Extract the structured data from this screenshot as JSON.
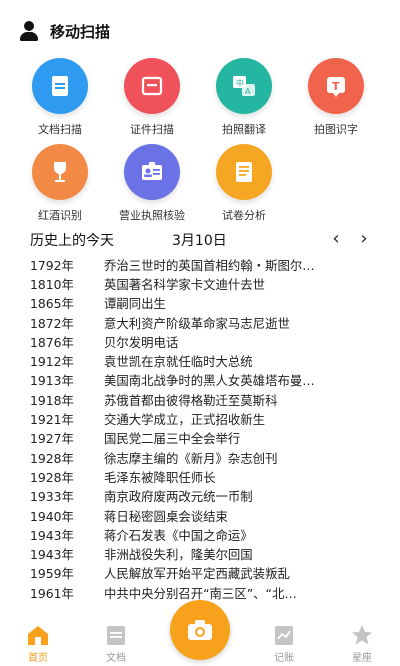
{
  "header": {
    "title": "移动扫描"
  },
  "tools": [
    {
      "label": "文档扫描",
      "color": "#2f9bf0",
      "icon": "document-icon"
    },
    {
      "label": "证件扫描",
      "color": "#f0525a",
      "icon": "id-card-icon"
    },
    {
      "label": "拍照翻译",
      "color": "#25b6a2",
      "icon": "translate-icon"
    },
    {
      "label": "拍图识字",
      "color": "#f0634c",
      "icon": "text-recognition-icon"
    },
    {
      "label": "红酒识别",
      "color": "#f28a45",
      "icon": "wine-glass-icon"
    },
    {
      "label": "营业执照核验",
      "color": "#6b72e6",
      "icon": "license-icon"
    },
    {
      "label": "试卷分析",
      "color": "#f5a623",
      "icon": "exam-paper-icon"
    }
  ],
  "history": {
    "title": "历史上的今天",
    "date": "3月10日",
    "prev": "‹",
    "next": "›",
    "events": [
      {
        "year": "1792年",
        "text": "乔治三世时的英国首相约翰・斯图尔…"
      },
      {
        "year": "1810年",
        "text": "英国著名科学家卡文迪什去世"
      },
      {
        "year": "1865年",
        "text": "谭嗣同出生"
      },
      {
        "year": "1872年",
        "text": "意大利资产阶级革命家马志尼逝世"
      },
      {
        "year": "1876年",
        "text": "贝尔发明电话"
      },
      {
        "year": "1912年",
        "text": "袁世凯在京就任临时大总统"
      },
      {
        "year": "1913年",
        "text": "美国南北战争时的黑人女英雄塔布曼…"
      },
      {
        "year": "1918年",
        "text": "苏俄首都由彼得格勒迁至莫斯科"
      },
      {
        "year": "1921年",
        "text": "交通大学成立，正式招收新生"
      },
      {
        "year": "1927年",
        "text": "国民党二届三中全会举行"
      },
      {
        "year": "1928年",
        "text": "徐志摩主编的《新月》杂志创刊"
      },
      {
        "year": "1928年",
        "text": "毛泽东被降职任师长"
      },
      {
        "year": "1933年",
        "text": "南京政府废两改元统一币制"
      },
      {
        "year": "1940年",
        "text": "蒋日秘密圆桌会谈结束"
      },
      {
        "year": "1943年",
        "text": "蒋介石发表《中国之命运》"
      },
      {
        "year": "1943年",
        "text": "非洲战役失利，隆美尔回国"
      },
      {
        "year": "1959年",
        "text": "人民解放军开始平定西藏武装叛乱"
      },
      {
        "year": "1961年",
        "text": "中共中央分别召开“南三区”、“北…"
      }
    ]
  },
  "tabbar": {
    "tabs": [
      {
        "label": "首页",
        "active": true,
        "icon": "home-icon"
      },
      {
        "label": "文档",
        "active": false,
        "icon": "document-tab-icon"
      },
      {
        "label": "记账",
        "active": false,
        "icon": "ledger-icon"
      },
      {
        "label": "星座",
        "active": false,
        "icon": "star-icon"
      }
    ],
    "camera": {
      "icon": "camera-icon"
    }
  },
  "colors": {
    "accent": "#f7a11c",
    "inactive": "#b5b5b5"
  }
}
